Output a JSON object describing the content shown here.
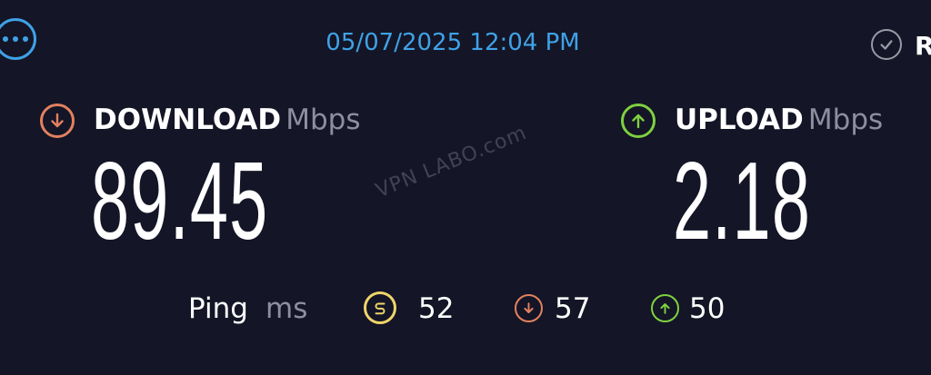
{
  "header": {
    "timestamp": "05/07/2025 12:04 PM",
    "more_icon": "more-options-icon",
    "results_label": "R",
    "results_icon": "check-circle-icon"
  },
  "download": {
    "label": "DOWNLOAD",
    "unit": "Mbps",
    "value": "89.45",
    "icon": "arrow-down-circle-icon",
    "color": "#e2815f"
  },
  "upload": {
    "label": "UPLOAD",
    "unit": "Mbps",
    "value": "2.18",
    "icon": "arrow-up-circle-icon",
    "color": "#7ed140"
  },
  "watermark": "VPN LABO.com",
  "ping": {
    "label": "Ping",
    "unit": "ms",
    "idle_value": "52",
    "idle_color": "#f0d56a",
    "download_value": "57",
    "upload_value": "50"
  },
  "colors": {
    "background": "#141526",
    "accent": "#3fa2e6",
    "muted": "#8e8ea0"
  }
}
